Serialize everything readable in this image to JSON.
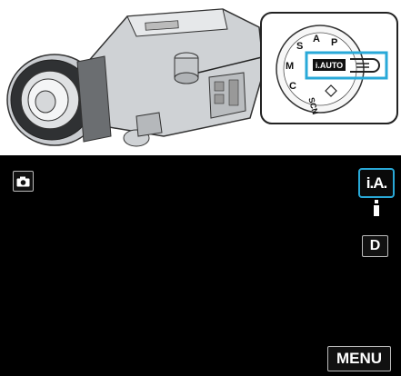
{
  "mode_dial": {
    "labels": [
      "A",
      "S",
      "M",
      "C",
      "SCN",
      "P"
    ],
    "selected": "i.AUTO"
  },
  "lcd": {
    "mode_button": "i.A.",
    "d_button": "D",
    "menu_button": "MENU",
    "camera_icon": "camera-icon"
  },
  "colors": {
    "highlight": "#29a9d8",
    "screen_bg": "#000000"
  }
}
